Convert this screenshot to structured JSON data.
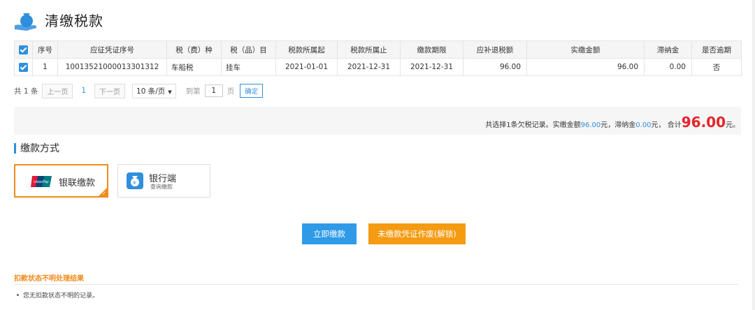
{
  "header": {
    "title": "清缴税款",
    "icon": "money-bag-hand-icon"
  },
  "table": {
    "headers": [
      "序号",
      "应征凭证序号",
      "税（费）种",
      "税（品）目",
      "税款所属起",
      "税款所属止",
      "缴款期限",
      "应补退税额",
      "实缴金额",
      "滞纳金",
      "是否逾期"
    ],
    "rows": [
      {
        "index": "1",
        "voucher": "10013521000013301312",
        "tax_type": "车船税",
        "item": "挂车",
        "start": "2021-01-01",
        "end": "2021-12-31",
        "deadline": "2021-12-31",
        "due": "96.00",
        "paid": "96.00",
        "late_fee": "0.00",
        "overdue": "否"
      }
    ]
  },
  "pager": {
    "total": "共 1 条",
    "prev": "上一页",
    "page": "1",
    "next": "下一页",
    "page_size": "10 条/页",
    "goto_prefix": "到第",
    "goto_value": "1",
    "goto_suffix": "页",
    "confirm": "确定"
  },
  "summary": {
    "prefix": "共选择1条欠税记录。实缴金额",
    "paid": "96.00",
    "unit1": " 元，滞纳金 ",
    "late": "0.00",
    "unit2": "元， 合计",
    "total": "96.00",
    "unit3": "元。"
  },
  "payment": {
    "section_title": "缴款方式",
    "methods": [
      {
        "label": "银联缴款",
        "icon": "unionpay-icon",
        "selected": true
      },
      {
        "label": "银行端",
        "sub": "查询缴款",
        "icon": "bank-icon",
        "selected": false
      }
    ]
  },
  "actions": {
    "pay_now": "立即缴款",
    "void_voucher": "未缴款凭证作废(解锁)"
  },
  "notice": {
    "title": "扣款状态不明处理结果",
    "item": "您无扣款状态不明的记录。"
  },
  "colors": {
    "accent": "#2f8fde",
    "orange": "#f59b12",
    "red": "#e8232a"
  }
}
